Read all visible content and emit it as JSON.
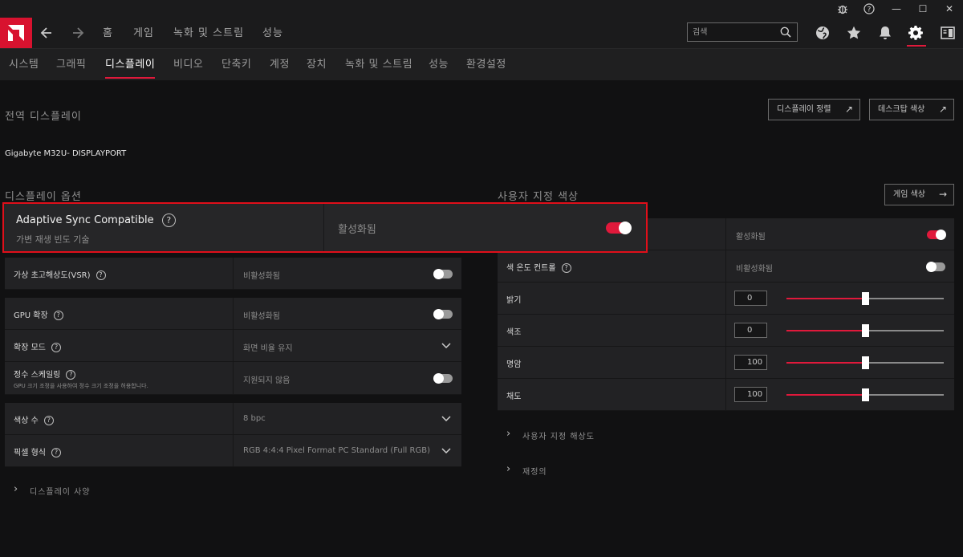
{
  "titlebar": {
    "bug_icon": "bug-icon",
    "help_icon": "help-circle-icon",
    "minimize": "—",
    "maximize": "☐",
    "close": "✕"
  },
  "nav": {
    "back_icon": "arrow-left-icon",
    "forward_icon": "arrow-right-icon",
    "items": [
      "홈",
      "게임",
      "녹화 및 스트림",
      "성능"
    ],
    "search_placeholder": "검색",
    "icons": [
      "globe-icon",
      "star-icon",
      "bell-icon",
      "gear-icon",
      "sidebar-icon"
    ]
  },
  "subnav": {
    "tabs": [
      "시스템",
      "그래픽",
      "디스플레이",
      "비디오",
      "단축키",
      "계정",
      "장치",
      "녹화 및 스트림",
      "성능",
      "환경설정"
    ],
    "active_index": 2
  },
  "global_display": {
    "title": "전역 디스플레이",
    "buttons": [
      {
        "label": "디스플레이 정렬",
        "arrow": "↗"
      },
      {
        "label": "데스크탑 색상",
        "arrow": "↗"
      }
    ],
    "monitor": "Gigabyte M32U- DISPLAYPORT"
  },
  "display_options": {
    "title": "디스플레이 옵션",
    "adaptive_sync": {
      "label": "Adaptive Sync Compatible",
      "sub": "가변 재생 빈도 기술",
      "value": "활성화됨",
      "toggle_on": true
    },
    "rows": [
      {
        "label": "가상 초고해상도(VSR)",
        "value": "비활성화됨",
        "control": "toggle",
        "on": false
      },
      {
        "label": "GPU 확장",
        "value": "비활성화됨",
        "control": "toggle",
        "on": false
      },
      {
        "label": "확장 모드",
        "value": "화면 비율 유지",
        "control": "dropdown"
      },
      {
        "label": "정수 스케일링",
        "sub": "GPU 크기 조정을 사용하여 정수 크기 조정을 허용합니다.",
        "value": "지원되지 않음",
        "control": "toggle",
        "on": false
      },
      {
        "label": "색상 수",
        "value": "8 bpc",
        "control": "dropdown"
      },
      {
        "label": "픽셀 형식",
        "value": "RGB 4:4:4 Pixel Format PC Standard (Full RGB)",
        "control": "dropdown"
      }
    ],
    "expander": "디스플레이 사양"
  },
  "custom_color": {
    "title": "사용자 지정 색상",
    "button": {
      "label": "게임 색상",
      "arrow": "→"
    },
    "enable_row": {
      "value": "활성화됨",
      "on": true
    },
    "temp_row": {
      "label": "색 온도 컨트롤",
      "value": "비활성화됨",
      "on": false
    },
    "sliders": [
      {
        "label": "밝기",
        "value": "0",
        "position": 0.5
      },
      {
        "label": "색조",
        "value": "0",
        "position": 0.5
      },
      {
        "label": "명암",
        "value": "100",
        "position": 0.5
      },
      {
        "label": "채도",
        "value": "100",
        "position": 0.5
      }
    ],
    "expanders": [
      "사용자 지정 해상도",
      "재정의"
    ]
  },
  "colors": {
    "accent": "#e0193b",
    "highlight_border": "#e00f1a",
    "bg": "#111112",
    "card": "#222224"
  }
}
